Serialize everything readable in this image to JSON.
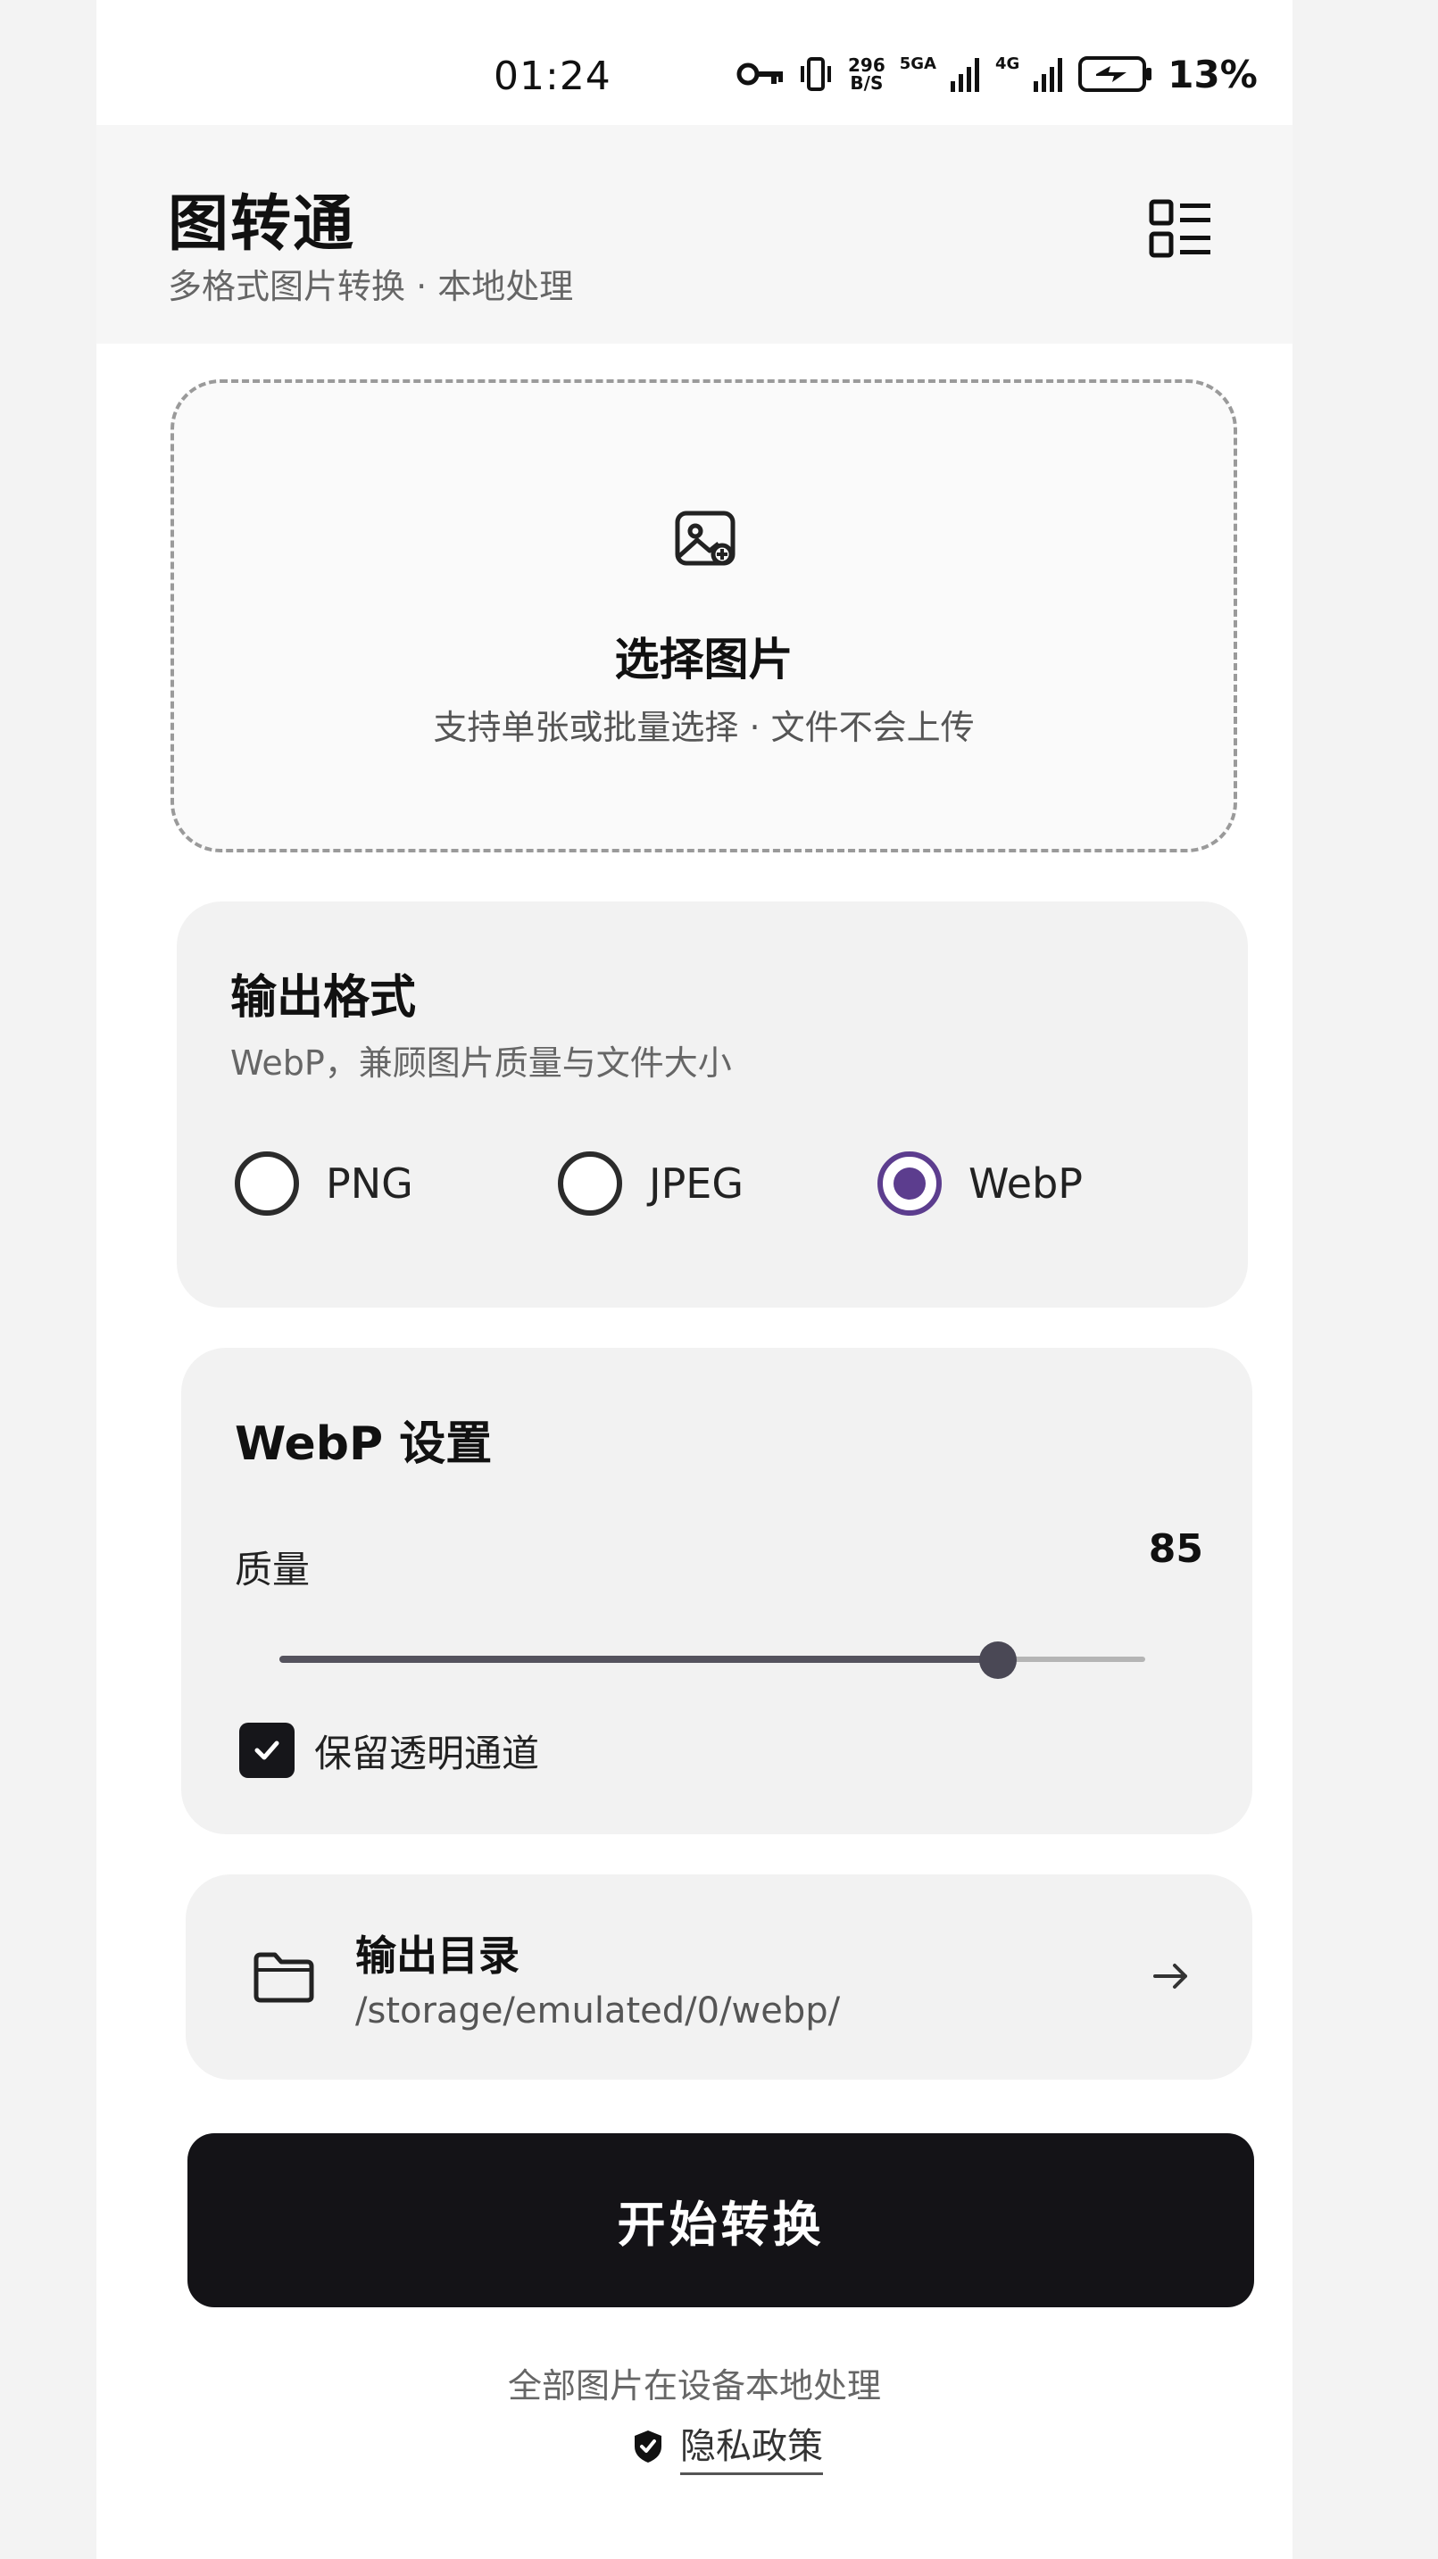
{
  "status_bar": {
    "time": "01:24",
    "speed_top": "296",
    "speed_bottom": "B/S",
    "net_1": "5GA",
    "net_2": "4G",
    "battery": "13%",
    "icons": [
      "key-icon",
      "vibrate-icon",
      "signal-icon",
      "signal-icon",
      "battery-icon"
    ]
  },
  "header": {
    "title": "图转通",
    "subtitle": "多格式图片转换 · 本地处理",
    "menu_icon": "grid-list-icon"
  },
  "upload": {
    "icon": "image-add-icon",
    "title": "选择图片",
    "hint": "支持单张或批量选择 · 文件不会上传"
  },
  "format": {
    "title": "输出格式",
    "description": "WebP，兼顾图片质量与文件大小",
    "options": [
      {
        "label": "PNG",
        "selected": false
      },
      {
        "label": "JPEG",
        "selected": false
      },
      {
        "label": "WebP",
        "selected": true
      }
    ],
    "accent_color": "#5c3d8e"
  },
  "webp_settings": {
    "title": "WebP 设置",
    "quality_label": "质量",
    "quality_value": "85",
    "quality_fraction": 0.83,
    "keep_alpha_label": "保留透明通道",
    "keep_alpha_checked": true
  },
  "output_dir": {
    "icon": "folder-icon",
    "title": "输出目录",
    "path": "/storage/emulated/0/webp/",
    "arrow_icon": "arrow-right-icon"
  },
  "actions": {
    "start_label": "开始转换"
  },
  "footer": {
    "note": "全部图片在设备本地处理",
    "privacy_label": "隐私政策",
    "privacy_icon": "shield-check-icon"
  }
}
